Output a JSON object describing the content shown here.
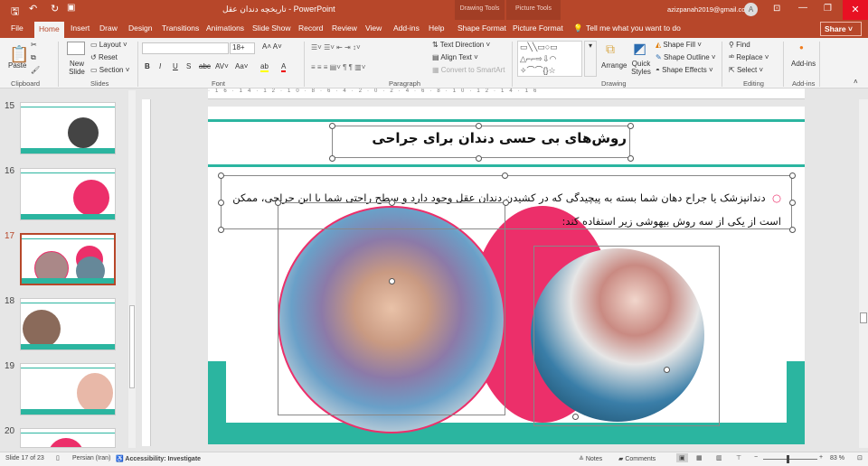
{
  "titlebar": {
    "title": "تاریخچه دندان عقل  -  PowerPoint",
    "account": "azizpanah2019@gmail.com",
    "avatar": "A",
    "context_drawing": "Drawing Tools",
    "context_picture": "Picture Tools"
  },
  "tabs": [
    "File",
    "Home",
    "Insert",
    "Draw",
    "Design",
    "Transitions",
    "Animations",
    "Slide Show",
    "Record",
    "Review",
    "View",
    "Add-ins",
    "Help",
    "Shape Format",
    "Picture Format"
  ],
  "active_tab": "Home",
  "tell_me": "Tell me what you want to do",
  "share": "Share",
  "ribbon": {
    "clipboard": {
      "paste": "Paste",
      "label": "Clipboard"
    },
    "slides": {
      "new_slide": "New Slide",
      "layout": "Layout",
      "reset": "Reset",
      "section": "Section",
      "label": "Slides"
    },
    "font": {
      "font_name": "",
      "font_size": "18+",
      "label": "Font"
    },
    "paragraph": {
      "text_direction": "Text Direction",
      "align_text": "Align Text",
      "convert": "Convert to SmartArt",
      "label": "Paragraph"
    },
    "drawing": {
      "arrange": "Arrange",
      "quick_styles": "Quick Styles",
      "shape_fill": "Shape Fill",
      "shape_outline": "Shape Outline",
      "shape_effects": "Shape Effects",
      "label": "Drawing"
    },
    "editing": {
      "find": "Find",
      "replace": "Replace",
      "select": "Select",
      "label": "Editing"
    },
    "addins": {
      "button": "Add-ins",
      "label": "Add-ins"
    }
  },
  "thumbnails": [
    {
      "num": "15"
    },
    {
      "num": "16"
    },
    {
      "num": "17",
      "selected": true
    },
    {
      "num": "18"
    },
    {
      "num": "19"
    },
    {
      "num": "20"
    }
  ],
  "slide": {
    "title": "روش‌های بی حسی دندان برای جراحی",
    "body_line1": "دندانپزشک یا جراح دهان شما بسته به پیچیدگی که در کشیدن دندان عقل وجود دارد و سطح راحتی شما با این جراحی، ممکن",
    "body_line2": "است از یکی از سه روش بیهوشی زیر استفاده کند:"
  },
  "colors": {
    "accent": "#b7472a",
    "teal": "#2bb5a0",
    "pink": "#ec2f6a"
  },
  "status": {
    "slide": "Slide 17 of 23",
    "language": "Persian (Iran)",
    "accessibility": "Accessibility: Investigate",
    "notes": "Notes",
    "comments": "Comments",
    "zoom": "83 %"
  }
}
